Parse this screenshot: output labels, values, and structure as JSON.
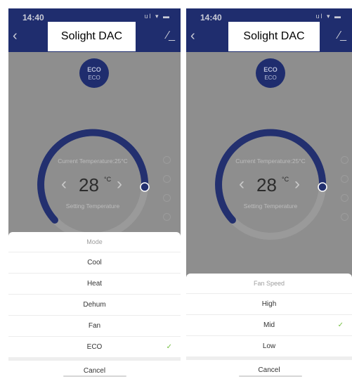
{
  "status": {
    "time": "14:40",
    "icons": "ul ▾ ▬"
  },
  "header": {
    "title": "Solight DAC"
  },
  "eco_badge": {
    "top": "ECO",
    "bottom": "ECO"
  },
  "dial": {
    "current_label": "Current Temperature:25°C",
    "temperature": "28",
    "unit": "°C",
    "setting_label": "Setting Temperature"
  },
  "side_icons": [
    "lock-icon",
    "timer-icon",
    "grid-icon",
    "sun-icon"
  ],
  "mode_sheet": {
    "title": "Mode",
    "items": [
      "Cool",
      "Heat",
      "Dehum",
      "Fan",
      "ECO"
    ],
    "selected": "ECO",
    "cancel": "Cancel"
  },
  "fan_sheet": {
    "title": "Fan Speed",
    "items": [
      "High",
      "Mid",
      "Low"
    ],
    "selected": "Mid",
    "cancel": "Cancel"
  },
  "colors": {
    "accent": "#1f2d6e",
    "overlay": "#8e8e8e",
    "check": "#76c043"
  }
}
